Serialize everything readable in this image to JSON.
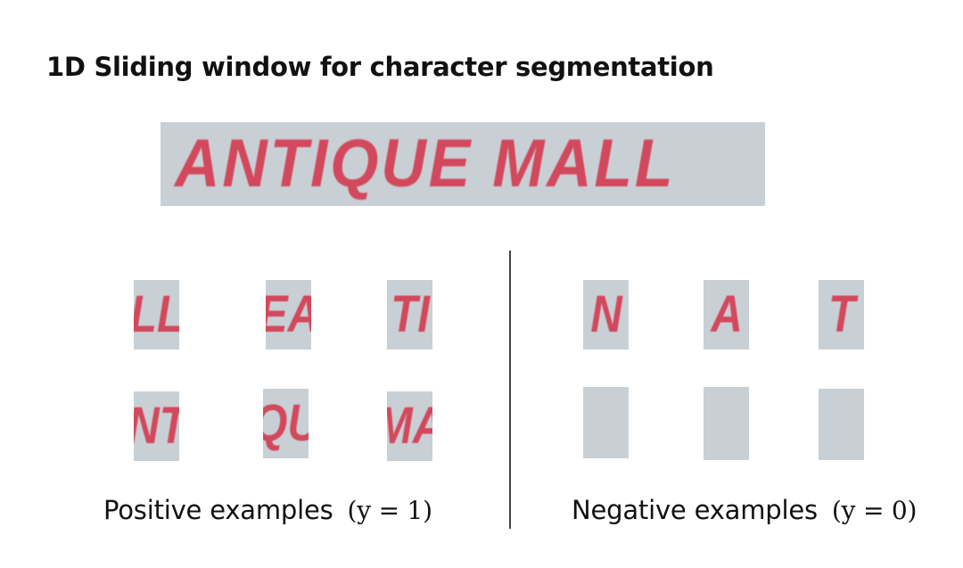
{
  "title": "1D Sliding window for character segmentation",
  "banner_text": "ANTIQUE MALL",
  "positive": {
    "label": "Positive examples",
    "equation": "(y = 1)",
    "patches": [
      "LL",
      "EA",
      "TI",
      "NT",
      "QU",
      "MA"
    ]
  },
  "negative": {
    "label": "Negative examples",
    "equation": "(y = 0)",
    "patches": [
      "N",
      "A",
      "T",
      "",
      "",
      ""
    ]
  },
  "colors": {
    "patch_background": "#c9d0d5",
    "letter_color": "#d2485c"
  }
}
